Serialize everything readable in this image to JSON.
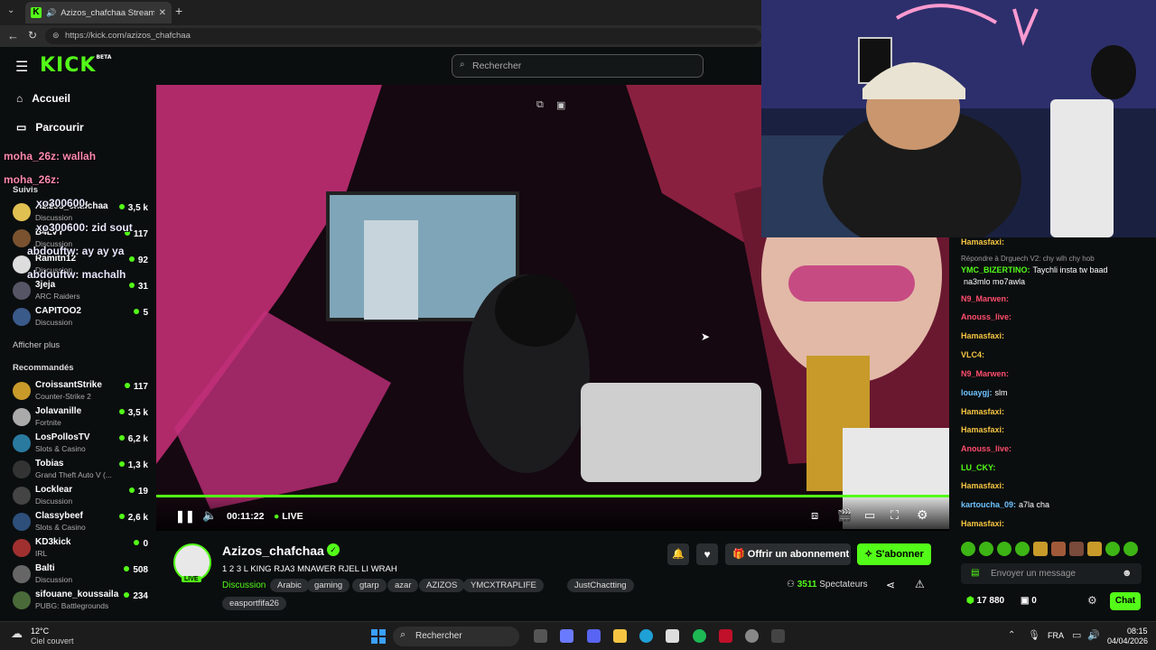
{
  "browser": {
    "tab_title": "Azizos_chafchaa Stream - Wa",
    "url": "https://kick.com/azizos_chafchaa"
  },
  "header": {
    "logo": "KICK",
    "logo_badge": "BETA",
    "search_placeholder": "Rechercher"
  },
  "nav": {
    "home": "Accueil",
    "browse": "Parcourir",
    "following": "Suivis",
    "show_more": "Afficher plus",
    "recommended": "Recommandés"
  },
  "followed": [
    {
      "name": "Azizos_chafchaa",
      "category": "Discussion",
      "viewers": "3,5 k"
    },
    {
      "name": "B4LVY",
      "category": "Discussion",
      "viewers": "117"
    },
    {
      "name": "Ramitn12",
      "category": "Discussion",
      "viewers": "92"
    },
    {
      "name": "3jeja",
      "category": "ARC Raiders",
      "viewers": "31"
    },
    {
      "name": "CAPITOO2",
      "category": "Discussion",
      "viewers": "5"
    }
  ],
  "recommended": [
    {
      "name": "CroissantStrike",
      "category": "Counter-Strike 2",
      "viewers": "117"
    },
    {
      "name": "Jolavanille",
      "category": "Fortnite",
      "viewers": "3,5 k"
    },
    {
      "name": "LosPollosTV",
      "category": "Slots & Casino",
      "viewers": "6,2 k"
    },
    {
      "name": "Tobias",
      "category": "Grand Theft Auto V (...",
      "viewers": "1,3 k"
    },
    {
      "name": "Locklear",
      "category": "Discussion",
      "viewers": "19"
    },
    {
      "name": "Classybeef",
      "category": "Slots & Casino",
      "viewers": "2,6 k"
    },
    {
      "name": "KD3kick",
      "category": "IRL",
      "viewers": "0"
    },
    {
      "name": "Balti",
      "category": "Discussion",
      "viewers": "508"
    },
    {
      "name": "sifouane_koussaila",
      "category": "PUBG: Battlegrounds",
      "viewers": "234"
    }
  ],
  "overlay_chat": [
    {
      "user": "moha_26z:",
      "text": "wallah"
    },
    {
      "user": "moha_26z:",
      "text": ""
    },
    {
      "user": "xo300600:",
      "text": ""
    },
    {
      "user": "xo300600:",
      "text": "zid sout"
    },
    {
      "user": "abdouftw:",
      "text": "ay ay ya"
    },
    {
      "user": "abdouftw:",
      "text": "machalh"
    }
  ],
  "player": {
    "time": "00:11:22",
    "live_label": "LIVE",
    "progress": 1.0
  },
  "stream": {
    "channel": "Azizos_chafchaa",
    "title": "1 2 3 L KING RJA3 MNAWER RJEL LI WRAH",
    "category": "Discussion",
    "live_badge": "LIVE",
    "tags": [
      "Arabic",
      "gaming",
      "gtarp",
      "azar",
      "AZIZOS",
      "YMCXTRAPLIFE",
      "JustChactting",
      "easportfifa26"
    ],
    "viewers": "3511",
    "viewers_label": "Spectateurs",
    "gift_label": "Offrir un abonnement",
    "subscribe_label": "S'abonner"
  },
  "chat": {
    "messages": [
      {
        "user": "Hamasfaxi:",
        "text": "",
        "color": "#f5c542"
      },
      {
        "user": "Répondre à Drguech V2: chy wlh chy hob",
        "text": "",
        "color": "#999999"
      },
      {
        "user": "YMC_BIZERTINO:",
        "text": "Taychli insta tw baad",
        "color": "#53fc18"
      },
      {
        "user": "",
        "text": "na3mlo mo7awla",
        "color": "#ffffff"
      },
      {
        "user": "N9_Marwen:",
        "text": "",
        "color": "#ff4d6d"
      },
      {
        "user": "Anouss_live:",
        "text": "",
        "color": "#ff4d6d"
      },
      {
        "user": "Hamasfaxi:",
        "text": "",
        "color": "#f5c542"
      },
      {
        "user": "VLC4:",
        "text": "",
        "color": "#f5c542"
      },
      {
        "user": "N9_Marwen:",
        "text": "",
        "color": "#ff4d6d"
      },
      {
        "user": "louaygj:",
        "text": "slm",
        "color": "#6fc3ff"
      },
      {
        "user": "Hamasfaxi:",
        "text": "",
        "color": "#f5c542"
      },
      {
        "user": "Hamasfaxi:",
        "text": "",
        "color": "#f5c542"
      },
      {
        "user": "Anouss_live:",
        "text": "",
        "color": "#ff4d6d"
      },
      {
        "user": "LU_CKY:",
        "text": "",
        "color": "#53fc18"
      },
      {
        "user": "Hamasfaxi:",
        "text": "",
        "color": "#f5c542"
      },
      {
        "user": "kartoucha_09:",
        "text": "a7la cha",
        "color": "#6fc3ff"
      },
      {
        "user": "Hamasfaxi:",
        "text": "",
        "color": "#f5c542"
      }
    ],
    "input_placeholder": "Envoyer un message",
    "points": "17 880",
    "gifts": "0",
    "send_label": "Chat"
  },
  "taskbar": {
    "weather_temp": "12°C",
    "weather_desc": "Ciel couvert",
    "search": "Rechercher",
    "lang": "FRA",
    "time": "08:15",
    "date": "04/04/2026"
  },
  "colors": {
    "accent": "#53fc18",
    "bg": "#0b0e0f"
  }
}
